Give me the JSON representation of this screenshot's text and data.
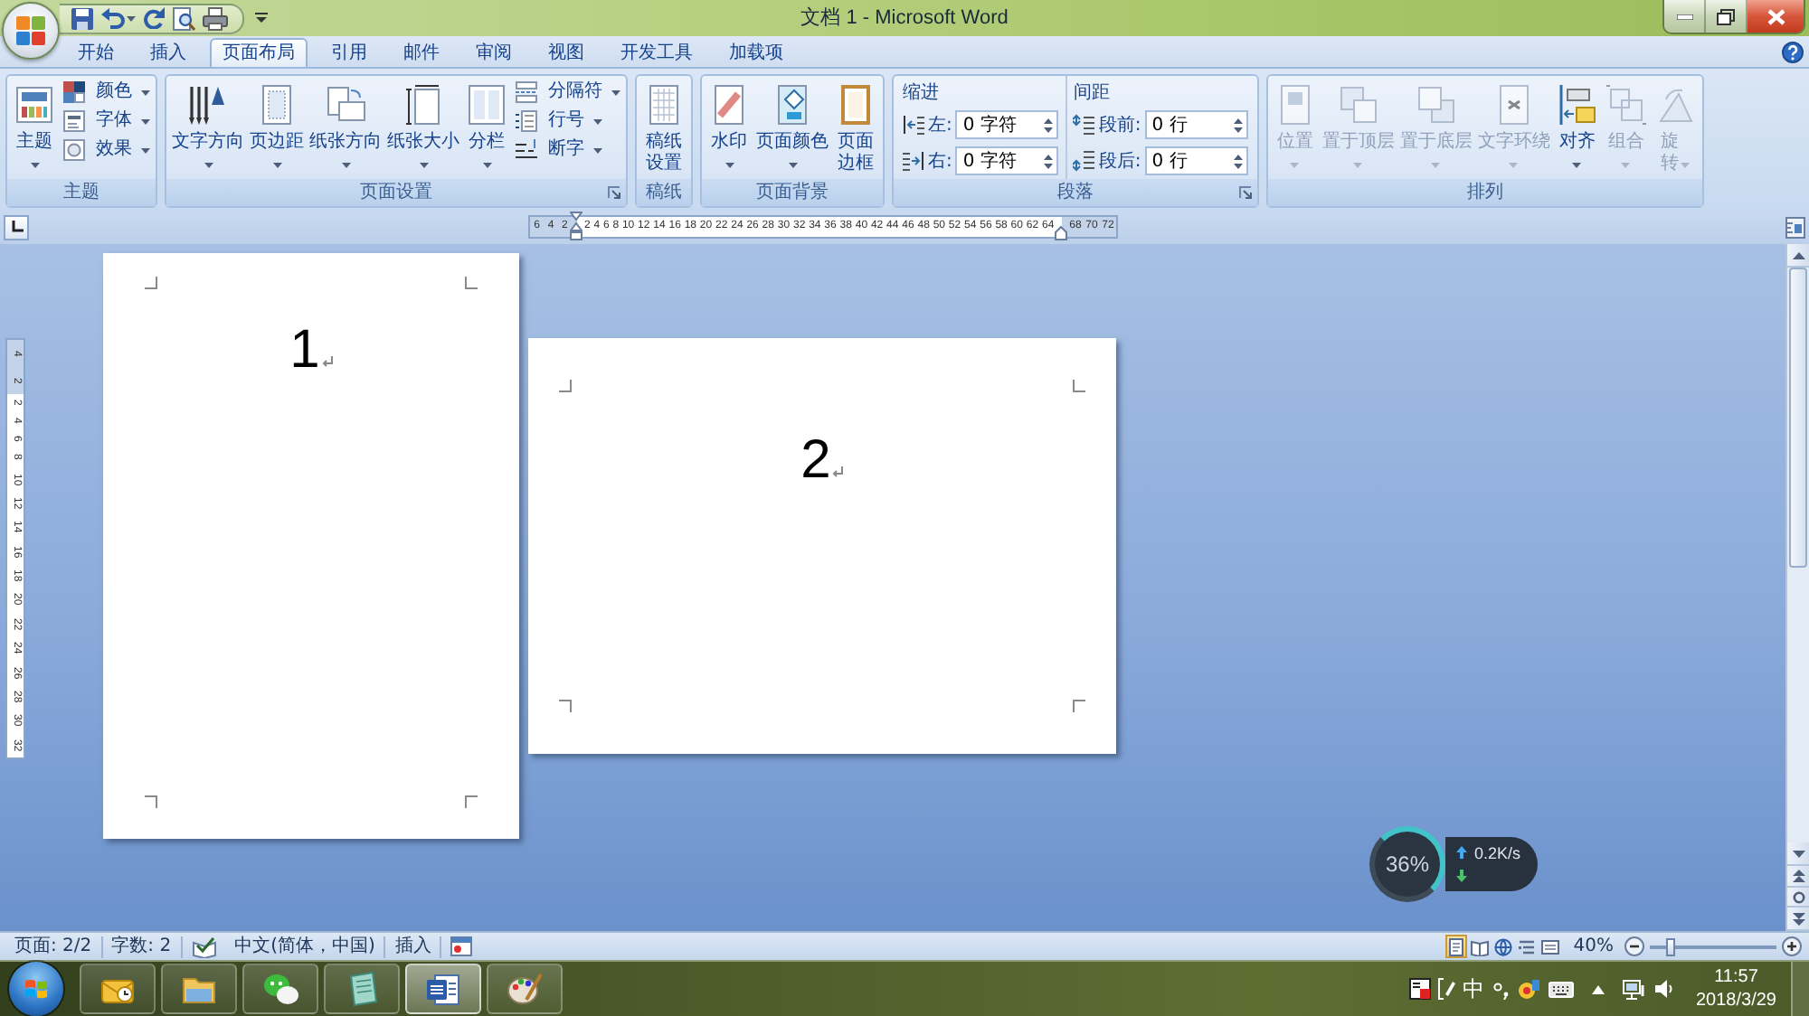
{
  "window": {
    "title": "文档 1 - Microsoft Word"
  },
  "tabs": [
    {
      "label": "开始",
      "selected": false
    },
    {
      "label": "插入",
      "selected": false
    },
    {
      "label": "页面布局",
      "selected": true
    },
    {
      "label": "引用",
      "selected": false
    },
    {
      "label": "邮件",
      "selected": false
    },
    {
      "label": "审阅",
      "selected": false
    },
    {
      "label": "视图",
      "selected": false
    },
    {
      "label": "开发工具",
      "selected": false
    },
    {
      "label": "加载项",
      "selected": false
    }
  ],
  "ribbon": {
    "groups": [
      {
        "title": "主题",
        "kind": "buttons",
        "launcher": false,
        "items": [
          {
            "kind": "large",
            "label": "主题",
            "dropdown": true
          },
          {
            "kind": "small",
            "label": "颜色",
            "dropdown": true
          },
          {
            "kind": "small",
            "label": "字体",
            "dropdown": true
          },
          {
            "kind": "small",
            "label": "效果",
            "dropdown": true
          }
        ]
      },
      {
        "title": "页面设置",
        "kind": "buttons",
        "launcher": true,
        "items": [
          {
            "kind": "large",
            "label": "文字方向",
            "dropdown": true
          },
          {
            "kind": "large",
            "label": "页边距",
            "dropdown": true
          },
          {
            "kind": "large",
            "label": "纸张方向",
            "dropdown": true
          },
          {
            "kind": "large",
            "label": "纸张大小",
            "dropdown": true
          },
          {
            "kind": "large",
            "label": "分栏",
            "dropdown": true
          },
          {
            "kind": "small",
            "label": "分隔符",
            "dropdown": true
          },
          {
            "kind": "small",
            "label": "行号",
            "dropdown": true
          },
          {
            "kind": "small",
            "label": "断字",
            "dropdown": true
          }
        ]
      },
      {
        "title": "稿纸",
        "kind": "buttons",
        "launcher": false,
        "items": [
          {
            "kind": "narrow",
            "label": "稿纸设置",
            "dropdown": false
          }
        ]
      },
      {
        "title": "页面背景",
        "kind": "buttons",
        "launcher": false,
        "items": [
          {
            "kind": "large",
            "label": "水印",
            "dropdown": true
          },
          {
            "kind": "large",
            "label": "页面颜色",
            "dropdown": true
          },
          {
            "kind": "narrow",
            "label": "页面边框",
            "dropdown": false
          }
        ]
      },
      {
        "title": "段落",
        "kind": "fields",
        "launcher": true,
        "sections": [
          {
            "label": "缩进",
            "fields": [
              {
                "label": "左:",
                "value": "0 字符"
              },
              {
                "label": "右:",
                "value": "0 字符"
              }
            ]
          },
          {
            "label": "间距",
            "fields": [
              {
                "label": "段前:",
                "value": "0 行"
              },
              {
                "label": "段后:",
                "value": "0 行"
              }
            ]
          }
        ]
      },
      {
        "title": "排列",
        "kind": "buttons",
        "launcher": false,
        "items": [
          {
            "kind": "large",
            "label": "位置",
            "dropdown": true,
            "disabled": true
          },
          {
            "kind": "large",
            "label": "置于顶层",
            "dropdown": true,
            "disabled": true
          },
          {
            "kind": "large",
            "label": "置于底层",
            "dropdown": true,
            "disabled": true
          },
          {
            "kind": "large",
            "label": "文字环绕",
            "dropdown": true,
            "disabled": true
          },
          {
            "kind": "large",
            "label": "对齐",
            "dropdown": true,
            "disabled": false
          },
          {
            "kind": "large",
            "label": "组合",
            "dropdown": true,
            "disabled": true
          },
          {
            "kind": "narrow",
            "label": "旋转",
            "dropdown": true,
            "disabled": true
          }
        ]
      }
    ]
  },
  "horizontal_ruler": {
    "left_margin_labels": [
      "6",
      "4",
      "2"
    ],
    "labels": [
      "2",
      "4",
      "6",
      "8",
      "10",
      "12",
      "14",
      "16",
      "18",
      "20",
      "22",
      "24",
      "26",
      "28",
      "30",
      "32",
      "34",
      "36",
      "38",
      "40",
      "42",
      "44",
      "46",
      "48",
      "50",
      "52",
      "54",
      "56",
      "58",
      "60",
      "62",
      "64"
    ],
    "right_margin_labels": [
      "68",
      "70",
      "72"
    ]
  },
  "vertical_ruler": {
    "top_margin_labels": [
      "4",
      "2"
    ],
    "labels": [
      "2",
      "4",
      "6",
      "8",
      "10",
      "12",
      "14",
      "16",
      "18",
      "20",
      "22",
      "24",
      "26",
      "28",
      "30",
      "32"
    ]
  },
  "pages": [
    {
      "number": "1",
      "kind": "portrait"
    },
    {
      "number": "2",
      "kind": "landscape"
    }
  ],
  "speed_widget": {
    "percent": "36%",
    "upload": "0.2K/s"
  },
  "status_bar": {
    "page": "页面: 2/2",
    "word_count": "字数: 2",
    "language": "中文(简体，中国)",
    "mode": "插入",
    "views": [
      {
        "selected": true
      },
      {
        "selected": false
      },
      {
        "selected": false
      },
      {
        "selected": false
      },
      {
        "selected": false
      }
    ],
    "zoom": "40%",
    "zoom_slider": {
      "level": 0.17
    }
  },
  "taskbar": {
    "apps": [
      {
        "selected": false
      },
      {
        "selected": false
      },
      {
        "selected": false
      },
      {
        "selected": false
      },
      {
        "selected": true
      },
      {
        "selected": false
      }
    ],
    "input_mode": "中",
    "time": "11:57",
    "date": "2018/3/29"
  }
}
